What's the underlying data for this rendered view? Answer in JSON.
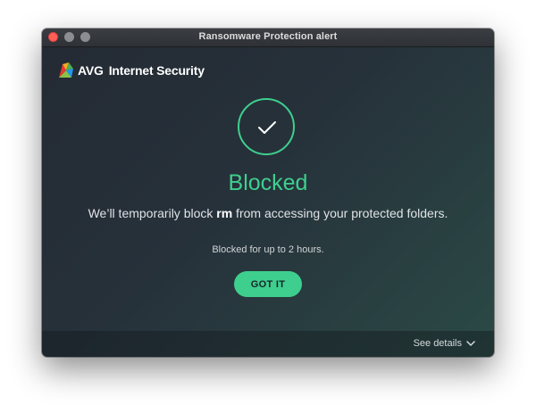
{
  "window": {
    "title": "Ransomware Protection alert"
  },
  "brand": {
    "name": "AVG",
    "product": "Internet Security",
    "logo_icon": "avg-logo-icon"
  },
  "alert": {
    "status_icon": "checkmark-icon",
    "status": "Blocked",
    "message_before": "We’ll temporarily block ",
    "process_name": "rm",
    "message_after": " from accessing your protected folders.",
    "duration": "Blocked for up to 2 hours.",
    "accent_color": "#3ecf8e"
  },
  "actions": {
    "primary_label": "GOT IT"
  },
  "footer": {
    "details_label": "See details",
    "details_icon": "chevron-down-icon"
  }
}
